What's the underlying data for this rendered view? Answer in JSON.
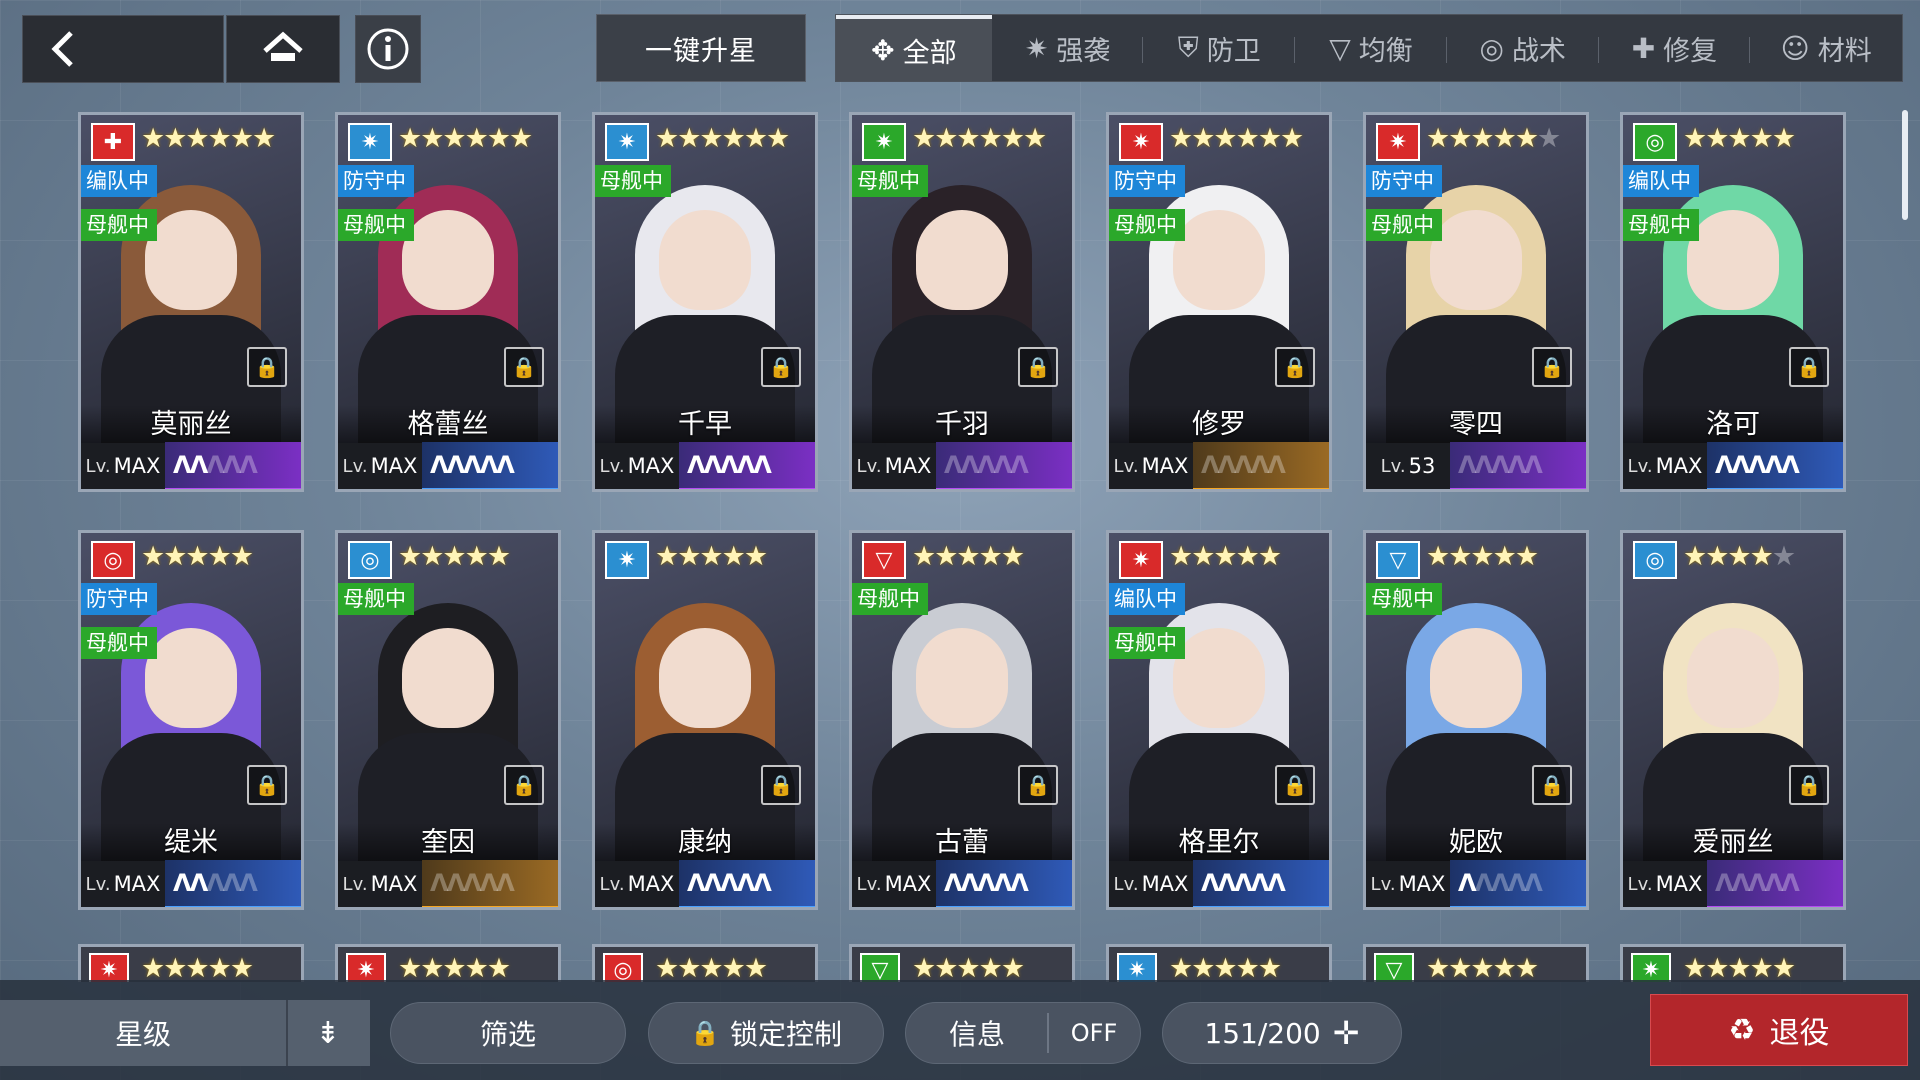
{
  "topbar": {
    "back_icon": "chevron-left-icon",
    "home_icon": "home-icon",
    "info_icon": "info-icon",
    "one_key_star_up": "一键升星"
  },
  "tabs": [
    {
      "label": "全部",
      "icon": "✥",
      "active": true
    },
    {
      "label": "强袭",
      "icon": "✷"
    },
    {
      "label": "防卫",
      "icon": "⛨"
    },
    {
      "label": "均衡",
      "icon": "▽"
    },
    {
      "label": "战术",
      "icon": "◎"
    },
    {
      "label": "修复",
      "icon": "✚"
    },
    {
      "label": "材料",
      "icon": "☺"
    }
  ],
  "cards": [
    {
      "name": "莫丽丝",
      "cls": "✚",
      "cls_color": "#d92a2a",
      "stars": 6,
      "max_stars": 6,
      "badges": [
        "编队中",
        "母舰中"
      ],
      "lv": "MAX",
      "rank_on": 2,
      "frame": "purple",
      "hair": "#8a5a3a"
    },
    {
      "name": "格蕾丝",
      "cls": "✷",
      "cls_color": "#2b8fd1",
      "stars": 6,
      "max_stars": 6,
      "badges": [
        "防守中",
        "母舰中"
      ],
      "lv": "MAX",
      "rank_on": 5,
      "frame": "blue",
      "hair": "#a02c56"
    },
    {
      "name": "千早",
      "cls": "✷",
      "cls_color": "#2b8fd1",
      "stars": 6,
      "max_stars": 6,
      "badges": [
        "母舰中"
      ],
      "lv": "MAX",
      "rank_on": 5,
      "frame": "purple",
      "hair": "#e8e8ee"
    },
    {
      "name": "千羽",
      "cls": "✷",
      "cls_color": "#2ba82a",
      "stars": 6,
      "max_stars": 6,
      "badges": [
        "母舰中"
      ],
      "lv": "MAX",
      "rank_on": 0,
      "frame": "purple",
      "hair": "#2a2228"
    },
    {
      "name": "修罗",
      "cls": "✷",
      "cls_color": "#d92a2a",
      "stars": 6,
      "max_stars": 6,
      "badges": [
        "防守中",
        "母舰中"
      ],
      "lv": "MAX",
      "rank_on": 0,
      "frame": "gold",
      "hair": "#f0f0f2"
    },
    {
      "name": "零四",
      "cls": "✷",
      "cls_color": "#d92a2a",
      "stars": 5,
      "max_stars": 6,
      "badges": [
        "防守中",
        "母舰中"
      ],
      "lv": "53",
      "rank_on": 0,
      "frame": "purple",
      "hair": "#e7d3a8"
    },
    {
      "name": "洛可",
      "cls": "◎",
      "cls_color": "#2ba82a",
      "stars": 5,
      "max_stars": 5,
      "badges": [
        "编队中",
        "母舰中"
      ],
      "lv": "MAX",
      "rank_on": 5,
      "frame": "blue",
      "hair": "#6fd8a6"
    },
    {
      "name": "缇米",
      "cls": "◎",
      "cls_color": "#d92a2a",
      "stars": 5,
      "max_stars": 5,
      "badges": [
        "防守中",
        "母舰中"
      ],
      "lv": "MAX",
      "rank_on": 2,
      "frame": "blue",
      "hair": "#7b58d8"
    },
    {
      "name": "奎因",
      "cls": "◎",
      "cls_color": "#2b8fd1",
      "stars": 5,
      "max_stars": 5,
      "badges": [
        "母舰中"
      ],
      "lv": "MAX",
      "rank_on": 0,
      "frame": "gold",
      "hair": "#1e1e22"
    },
    {
      "name": "康纳",
      "cls": "✷",
      "cls_color": "#2b8fd1",
      "stars": 5,
      "max_stars": 5,
      "badges": [],
      "lv": "MAX",
      "rank_on": 5,
      "frame": "blue",
      "hair": "#9c5e32"
    },
    {
      "name": "古蕾",
      "cls": "▽",
      "cls_color": "#d92a2a",
      "stars": 5,
      "max_stars": 5,
      "badges": [
        "母舰中"
      ],
      "lv": "MAX",
      "rank_on": 5,
      "frame": "blue",
      "hair": "#c9ccd3"
    },
    {
      "name": "格里尔",
      "cls": "✷",
      "cls_color": "#d92a2a",
      "stars": 5,
      "max_stars": 5,
      "badges": [
        "编队中",
        "母舰中"
      ],
      "lv": "MAX",
      "rank_on": 5,
      "frame": "blue",
      "hair": "#e3e3ea"
    },
    {
      "name": "妮欧",
      "cls": "▽",
      "cls_color": "#2b8fd1",
      "stars": 5,
      "max_stars": 5,
      "badges": [
        "母舰中"
      ],
      "lv": "MAX",
      "rank_on": 1,
      "frame": "blue",
      "hair": "#7aa8e6"
    },
    {
      "name": "爱丽丝",
      "cls": "◎",
      "cls_color": "#2b8fd1",
      "stars": 4,
      "max_stars": 5,
      "badges": [],
      "lv": "MAX",
      "rank_on": 0,
      "frame": "purple",
      "hair": "#f1e3c3"
    }
  ],
  "peek_row": [
    {
      "cls": "✷",
      "cls_color": "#d92a2a"
    },
    {
      "cls": "✷",
      "cls_color": "#d92a2a"
    },
    {
      "cls": "◎",
      "cls_color": "#d92a2a"
    },
    {
      "cls": "▽",
      "cls_color": "#2ba82a"
    },
    {
      "cls": "✷",
      "cls_color": "#2b8fd1"
    },
    {
      "cls": "▽",
      "cls_color": "#2ba82a"
    },
    {
      "cls": "✷",
      "cls_color": "#2ba82a"
    }
  ],
  "bottom": {
    "sort_label": "星级",
    "filter": "筛选",
    "lock_control": "锁定控制",
    "info": "信息",
    "info_toggle": "OFF",
    "capacity": "151/200",
    "retire": "退役"
  }
}
